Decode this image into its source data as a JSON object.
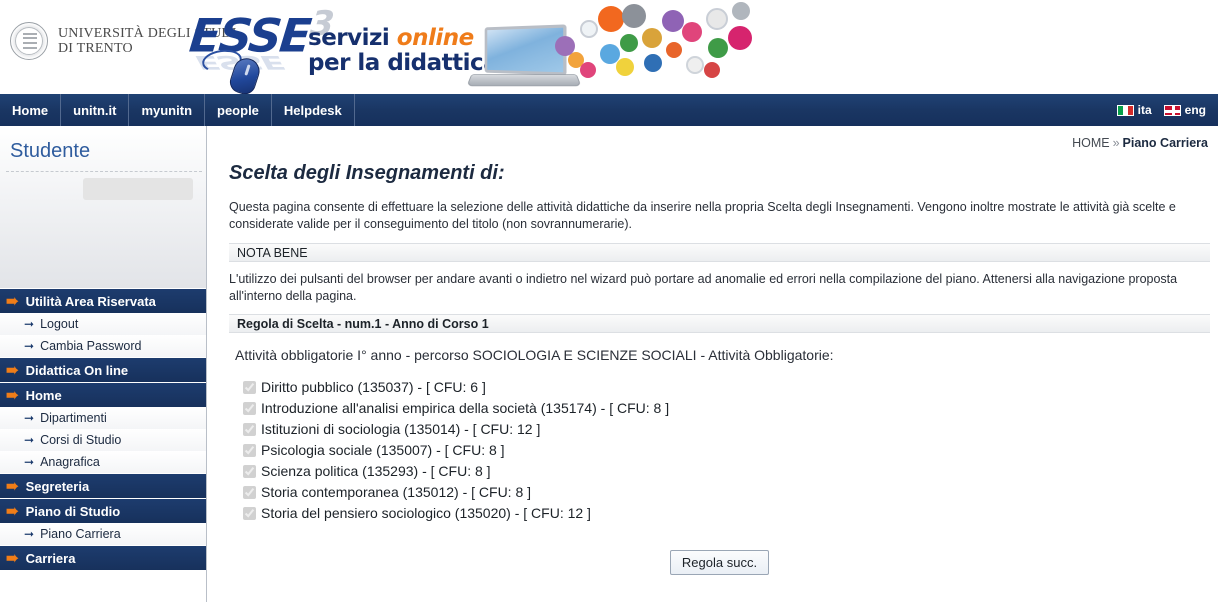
{
  "header": {
    "university_name_line1": "UNIVERSITÀ DEGLI STUDI",
    "university_name_line2": "DI TRENTO",
    "brand_main": "ESSE",
    "brand_sup": "3",
    "brand_reflection": "ESSE",
    "tagline_line1_plain": "servizi ",
    "tagline_line1_accent": "online",
    "tagline_line2": "per la didattica"
  },
  "nav": {
    "items": [
      {
        "label": "Home",
        "name": "nav-item-home"
      },
      {
        "label": "unitn.it",
        "name": "nav-item-unitn-it"
      },
      {
        "label": "myunitn",
        "name": "nav-item-myunitn"
      },
      {
        "label": "people",
        "name": "nav-item-people"
      },
      {
        "label": "Helpdesk",
        "name": "nav-item-helpdesk"
      }
    ],
    "lang_ita": "ita",
    "lang_eng": "eng"
  },
  "breadcrumb": {
    "home": "HOME",
    "separator": "»",
    "current": "Piano Carriera"
  },
  "sidebar": {
    "title": "Studente",
    "sections": [
      {
        "label": "Utilità Area Riservata",
        "name": "sidebar-section-utilita-area-riservata",
        "items": [
          {
            "label": "Logout",
            "name": "sidebar-item-logout"
          },
          {
            "label": "Cambia Password",
            "name": "sidebar-item-cambia-password"
          }
        ]
      },
      {
        "label": "Didattica On line",
        "name": "sidebar-section-didattica-on-line",
        "items": []
      },
      {
        "label": "Home",
        "name": "sidebar-section-home",
        "items": [
          {
            "label": "Dipartimenti",
            "name": "sidebar-item-dipartimenti"
          },
          {
            "label": "Corsi di Studio",
            "name": "sidebar-item-corsi-di-studio"
          },
          {
            "label": "Anagrafica",
            "name": "sidebar-item-anagrafica"
          }
        ]
      },
      {
        "label": "Segreteria",
        "name": "sidebar-section-segreteria",
        "items": []
      },
      {
        "label": "Piano di Studio",
        "name": "sidebar-section-piano-di-studio",
        "items": [
          {
            "label": "Piano Carriera",
            "name": "sidebar-item-piano-carriera"
          }
        ]
      },
      {
        "label": "Carriera",
        "name": "sidebar-section-carriera",
        "items": []
      }
    ]
  },
  "main": {
    "page_title": "Scelta degli Insegnamenti di:",
    "intro": "Questa pagina consente di effettuare la selezione delle attività didattiche da inserire nella propria Scelta degli Insegnamenti. Vengono inoltre mostrate le attività già scelte e considerate valide per il conseguimento del titolo (non sovrannumerarie).",
    "nota_bene_heading": "NOTA BENE",
    "nota_bene_text": "L'utilizzo dei pulsanti del browser per andare avanti o indietro nel wizard può portare ad anomalie ed errori nella compilazione del piano. Attenersi alla navigazione proposta all'interno della pagina.",
    "rule_bar": "Regola di Scelta - num.1 - Anno di Corso 1",
    "rule_subtitle": "Attività obbligatorie I° anno - percorso SOCIOLOGIA E SCIENZE SOCIALI - Attività Obbligatorie:",
    "courses": [
      {
        "label": "Diritto pubblico (135037) - [ CFU: 6 ]",
        "checked": true,
        "disabled": true
      },
      {
        "label": "Introduzione all'analisi empirica della società (135174) - [ CFU: 8 ]",
        "checked": true,
        "disabled": true
      },
      {
        "label": "Istituzioni di sociologia (135014) - [ CFU: 12 ]",
        "checked": true,
        "disabled": true
      },
      {
        "label": "Psicologia sociale (135007) - [ CFU: 8 ]",
        "checked": true,
        "disabled": true
      },
      {
        "label": "Scienza politica (135293) - [ CFU: 8 ]",
        "checked": true,
        "disabled": true
      },
      {
        "label": "Storia contemporanea (135012) - [ CFU: 8 ]",
        "checked": true,
        "disabled": true
      },
      {
        "label": "Storia del pensiero sociologico (135020) - [ CFU: 12 ]",
        "checked": true,
        "disabled": true
      }
    ],
    "next_button": "Regola succ."
  },
  "colors": {
    "nav_navy": "#1a3663",
    "accent_orange": "#ef7c1a",
    "brand_blue": "#16306e",
    "sidebar_title_blue": "#2f5c9e"
  }
}
